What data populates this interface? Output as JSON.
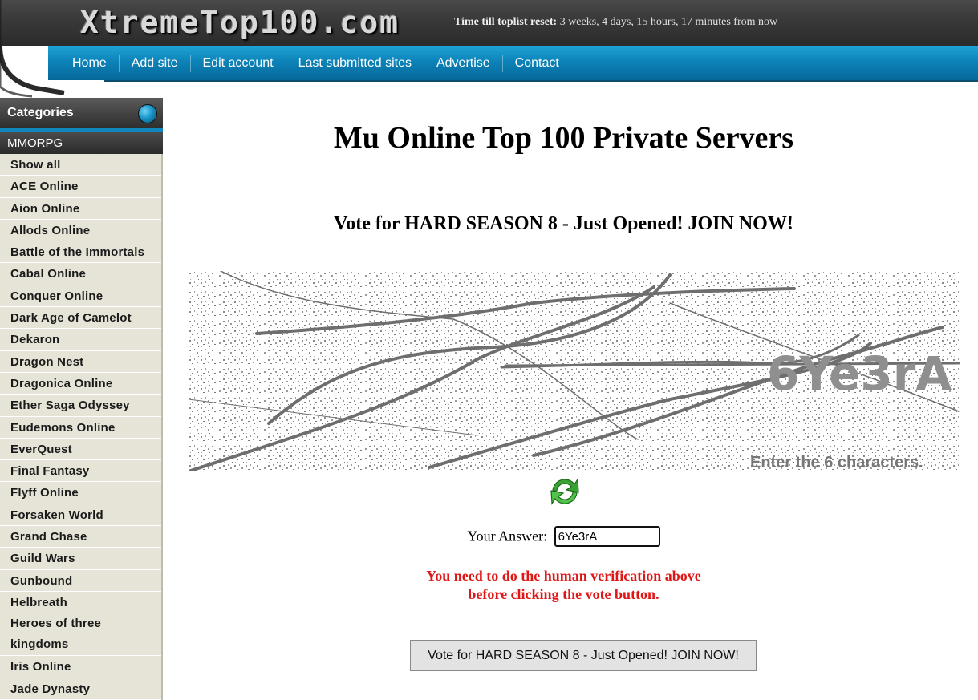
{
  "header": {
    "logo_text": "XtremeTop100.com",
    "reset_label": "Time till toplist reset:",
    "reset_value": "3 weeks, 4 days, 15 hours, 17 minutes from now",
    "nav": [
      "Home",
      "Add site",
      "Edit account",
      "Last submitted sites",
      "Advertise",
      "Contact"
    ]
  },
  "sidebar": {
    "title": "Categories",
    "group": "MMORPG",
    "items": [
      "Show all",
      "ACE Online",
      "Aion Online",
      "Allods Online",
      "Battle of the Immortals",
      "Cabal Online",
      "Conquer Online",
      "Dark Age of Camelot",
      "Dekaron",
      "Dragon Nest",
      "Dragonica Online",
      "Ether Saga Odyssey",
      "Eudemons Online",
      "EverQuest",
      "Final Fantasy",
      "Flyff Online",
      "Forsaken World",
      "Grand Chase",
      "Guild Wars",
      "Gunbound",
      "Helbreath",
      "Heroes of three kingdoms",
      "Iris Online",
      "Jade Dynasty"
    ]
  },
  "main": {
    "page_title": "Mu Online Top 100 Private Servers",
    "vote_heading": "Vote for HARD SEASON 8 - Just Opened! JOIN NOW!",
    "captcha": {
      "code_text": "6Ye3rA",
      "instruction": "Enter the 6 characters."
    },
    "answer_label": "Your Answer:",
    "answer_value": "6Ye3rA",
    "warning_line1": "You need to do the human verification above",
    "warning_line2": "before clicking the vote button.",
    "vote_button": "Vote for HARD SEASON 8 - Just Opened! JOIN NOW!"
  },
  "colors": {
    "nav_bar": "#0c83b8",
    "header_dark": "#3a3a3a",
    "sidebar_bg": "#e5e4d7",
    "warning": "#e01616"
  },
  "icons": {
    "refresh": "refresh-arrows-icon",
    "categories": "globe-icon"
  }
}
